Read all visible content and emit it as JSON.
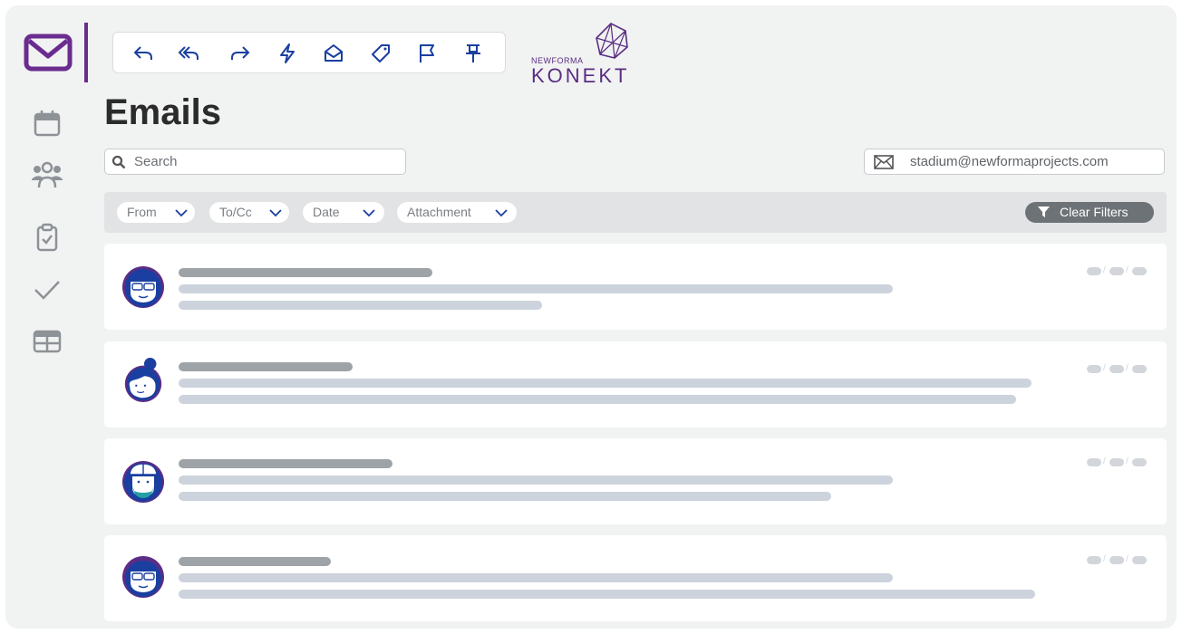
{
  "app": {
    "logo_small": "NEWFORMA",
    "logo_big": "KONEKT",
    "brand_color": "#5a2d82"
  },
  "rail": {
    "items": [
      {
        "name": "mail-icon",
        "active": true
      },
      {
        "name": "calendar-icon"
      },
      {
        "name": "contacts-icon"
      },
      {
        "name": "clipboard-icon"
      },
      {
        "name": "checkmark-icon"
      },
      {
        "name": "table-icon"
      }
    ]
  },
  "toolbar": {
    "icons": [
      "reply-icon",
      "reply-all-icon",
      "forward-icon",
      "quick-action-icon",
      "mark-read-icon",
      "tag-icon",
      "flag-icon",
      "pin-icon"
    ]
  },
  "page": {
    "title": "Emails"
  },
  "search": {
    "placeholder": "Search",
    "value": ""
  },
  "mailbox": {
    "address": "stadium@newformaprojects.com"
  },
  "filters": {
    "chips": [
      "From",
      "To/Cc",
      "Date",
      "Attachment"
    ],
    "clear_label": "Clear Filters"
  },
  "emails": [
    {
      "avatar": "man-glasses"
    },
    {
      "avatar": "woman-bun"
    },
    {
      "avatar": "construction-worker"
    },
    {
      "avatar": "man-glasses"
    }
  ]
}
